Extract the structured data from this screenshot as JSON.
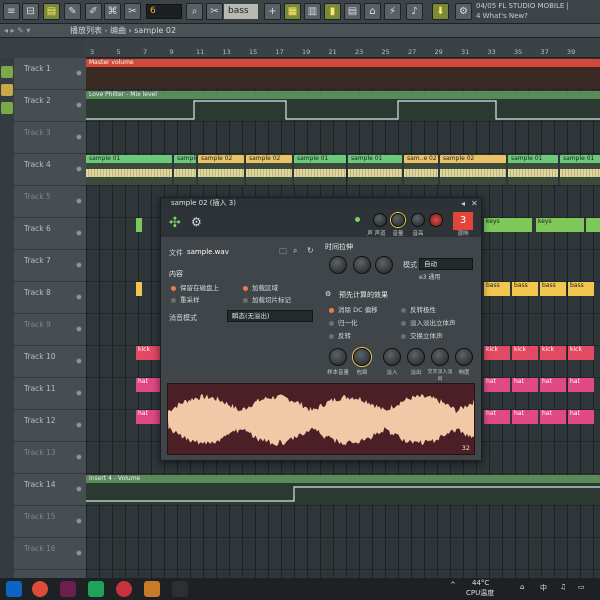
{
  "toolbar": {
    "pattern_value": "6",
    "snap_value": "bass",
    "fl_info_line1": "04/05  FL STUDIO MOBILE |",
    "fl_info_line2": "4 What's New?"
  },
  "playlist": {
    "breadcrumb": "播放列表 - 编曲 › sample 02",
    "ruler_ticks": [
      "3",
      "5",
      "7",
      "9",
      "11",
      "13",
      "15",
      "17",
      "19",
      "21",
      "23",
      "25",
      "27",
      "29",
      "31",
      "33",
      "35",
      "37",
      "39"
    ],
    "tracks": [
      "Track 1",
      "Track 2",
      "Track 3",
      "Track 4",
      "Track 5",
      "Track 6",
      "Track 7",
      "Track 8",
      "Track 9",
      "Track 10",
      "Track 11",
      "Track 12",
      "Track 13",
      "Track 14",
      "Track 15",
      "Track 16"
    ],
    "clips": {
      "master_volume": "Master volume",
      "love_philter": "Love Philter - Mix level",
      "insert_volume": "Insert 4 - Volume",
      "sample01": "sample 01",
      "sample02": "sample 02",
      "sample_misc": "sam..e 02",
      "keys": "keys",
      "bass": "bass",
      "kick": "kick",
      "hat": "hat"
    }
  },
  "dialog": {
    "title": "sample 02 (插入 3)",
    "close": "✕",
    "insert_number": "3",
    "top_knob_labels": [
      "声",
      "声道",
      "音量",
      "音高",
      "混响"
    ],
    "file_label": "文件",
    "file_value": "sample.wav",
    "content_title": "内容",
    "content_options": [
      "保留在磁盘上",
      "重采样",
      "加载区域",
      "加载切片标记"
    ],
    "declick_label": "消音模式",
    "declick_value": "瞬态(无溢出)",
    "time_stretch_title": "时间拉伸",
    "mode_label": "模式",
    "mode_value": "自动",
    "mode_sub": "e3 通用",
    "precomputed_title": "预先计算的效果",
    "effects": [
      "消除 DC 偏移",
      "反转极性",
      "归一化",
      "淡入淡出立体声",
      "反转",
      "交换立体声"
    ],
    "bottom_knob_labels": [
      "样本音量",
      "包络",
      "淡入",
      "淡出",
      "交叉淡入淡出",
      "响度"
    ],
    "zoom_value": "32"
  },
  "taskbar": {
    "temperature": "44°C",
    "cpu_label": "CPU温度"
  },
  "colors": {
    "accent_orange": "#f07b4a",
    "clip_green": "#6aca7a",
    "clip_yellow": "#e9c265",
    "clip_red": "#e24a64",
    "wave_bg": "#4a1f26",
    "wave_fg": "#f1c9a6"
  }
}
